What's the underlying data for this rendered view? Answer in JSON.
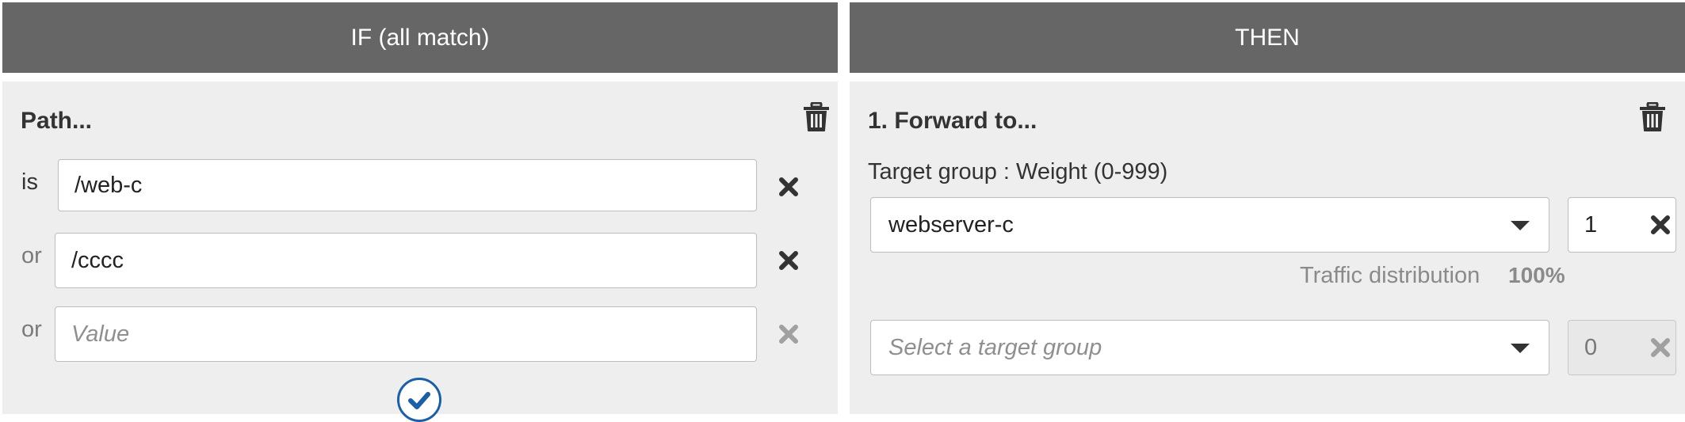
{
  "if_column": {
    "header": "IF (all match)",
    "condition": {
      "title": "Path...",
      "trash_icon": "trash-icon",
      "rows": [
        {
          "label": "is",
          "value": "/web-c"
        },
        {
          "label": "or",
          "value": "/cccc"
        },
        {
          "label": "or",
          "value": "",
          "placeholder": "Value"
        }
      ],
      "confirm_icon": "checkmark-icon"
    }
  },
  "then_column": {
    "header": "THEN",
    "action": {
      "title": "1. Forward to...",
      "trash_icon": "trash-icon",
      "target_group_label": "Target group : Weight (0-999)",
      "targets": [
        {
          "target_group": "webserver-c",
          "weight": "1"
        },
        {
          "target_group": "",
          "placeholder": "Select a target group",
          "weight": "0"
        }
      ],
      "traffic_distribution_label": "Traffic distribution",
      "traffic_distribution_value": "100%"
    }
  },
  "colors": {
    "header_bg": "#666666",
    "panel_bg": "#eeeeee",
    "accent": "#1a5fa8",
    "icon_dark": "#333333",
    "icon_muted": "#a0a0a0"
  }
}
